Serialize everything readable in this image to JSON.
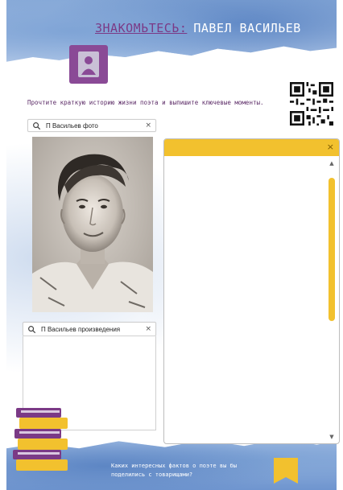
{
  "header": {
    "title_prefix": "ЗНАКОМЬТЕСЬ:",
    "title_name": "ПАВЕЛ ВАСИЛЬЕВ"
  },
  "instruction": "Прочтите краткую историю жизни поэта и  выпишите ключевые моменты.",
  "search_photo": {
    "value": "П Васильев фото",
    "close": "×"
  },
  "search_works": {
    "value": "П Васильев произведения",
    "close": "×"
  },
  "notes_panel": {
    "close": "×",
    "scroll_up": "▲",
    "scroll_down": "▼"
  },
  "footer": {
    "question": "Каких интересных фактов о поэте вы бы поделились с товарищами?"
  },
  "colors": {
    "accent_purple": "#8a4a96",
    "accent_yellow": "#f2c12e",
    "wash_blue": "#7fa4d6"
  },
  "icons": {
    "avatar": "person-icon",
    "search": "search-icon",
    "close": "close-icon",
    "books": "books-icon",
    "bookmark": "bookmark-icon",
    "qr": "qr-code"
  }
}
